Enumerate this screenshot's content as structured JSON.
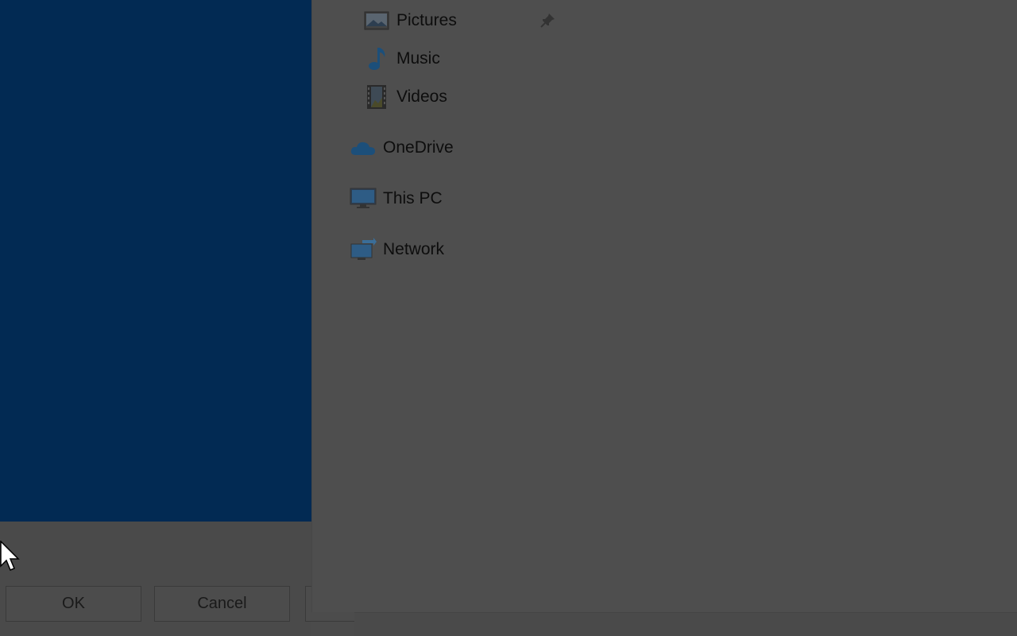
{
  "dialog": {
    "buttons": {
      "ok": "OK",
      "cancel": "Cancel"
    }
  },
  "explorer": {
    "nav": {
      "pictures": {
        "label": "Pictures",
        "icon": "pictures-icon",
        "pinned": true
      },
      "music": {
        "label": "Music",
        "icon": "music-icon"
      },
      "videos": {
        "label": "Videos",
        "icon": "videos-icon"
      },
      "onedrive": {
        "label": "OneDrive",
        "icon": "cloud-icon"
      },
      "thispc": {
        "label": "This PC",
        "icon": "monitor-icon"
      },
      "network": {
        "label": "Network",
        "icon": "network-icon"
      }
    }
  },
  "colors": {
    "dialog_blue": "#022a53",
    "overlay_gray": "#4e4e4e",
    "icon_blue": "#1c4f7a"
  }
}
